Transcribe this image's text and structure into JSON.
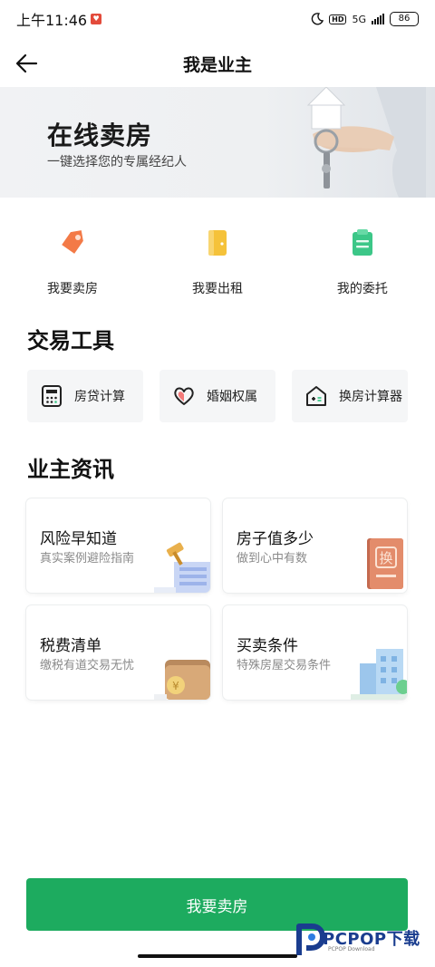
{
  "status_bar": {
    "time": "上午11:46",
    "network": "5G",
    "battery": "86"
  },
  "nav": {
    "title": "我是业主"
  },
  "banner": {
    "title": "在线卖房",
    "subtitle": "一键选择您的专属经纪人"
  },
  "actions": [
    {
      "label": "我要卖房",
      "icon": "tag-icon",
      "color": "#f37a47"
    },
    {
      "label": "我要出租",
      "icon": "door-icon",
      "color": "#f5c23a"
    },
    {
      "label": "我的委托",
      "icon": "clipboard-icon",
      "color": "#3cc788"
    }
  ],
  "tools_section": {
    "title": "交易工具"
  },
  "tools": [
    {
      "label": "房贷计算",
      "icon": "calculator-icon"
    },
    {
      "label": "婚姻权属",
      "icon": "heart-icon"
    },
    {
      "label": "换房计算器",
      "icon": "house-calc-icon"
    }
  ],
  "info_section": {
    "title": "业主资讯"
  },
  "info_cards": [
    {
      "title": "风险早知道",
      "subtitle": "真实案例避险指南",
      "icon": "gavel-icon"
    },
    {
      "title": "房子值多少",
      "subtitle": "做到心中有数",
      "icon": "property-cert-icon"
    },
    {
      "title": "税费清单",
      "subtitle": "缴税有道交易无忧",
      "icon": "wallet-icon"
    },
    {
      "title": "买卖条件",
      "subtitle": "特殊房屋交易条件",
      "icon": "building-icon"
    }
  ],
  "cta": {
    "label": "我要卖房",
    "color": "#1dab5f"
  },
  "watermark": {
    "text": "PCPOP下载",
    "sub": "PCPOP Download"
  }
}
